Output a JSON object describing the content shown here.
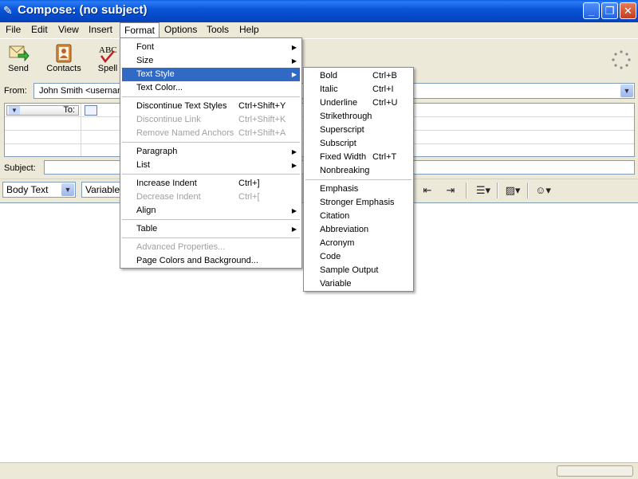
{
  "window": {
    "title": "Compose: (no subject)"
  },
  "menubar": [
    "File",
    "Edit",
    "View",
    "Insert",
    "Format",
    "Options",
    "Tools",
    "Help"
  ],
  "toolbar": {
    "send": "Send",
    "contacts": "Contacts",
    "spell": "Spell"
  },
  "from": {
    "label": "From:",
    "value": "John Smith <usernam"
  },
  "addressing": {
    "type": "To:"
  },
  "subject": {
    "label": "Subject:",
    "value": ""
  },
  "format_bar": {
    "paragraph_style": "Body Text",
    "font": "Variable"
  },
  "format_menu": {
    "font": "Font",
    "size": "Size",
    "text_style": "Text Style",
    "text_color": "Text Color...",
    "discontinue_styles": "Discontinue Text Styles",
    "discontinue_styles_sc": "Ctrl+Shift+Y",
    "discontinue_link": "Discontinue Link",
    "discontinue_link_sc": "Ctrl+Shift+K",
    "remove_anchors": "Remove Named Anchors",
    "remove_anchors_sc": "Ctrl+Shift+A",
    "paragraph": "Paragraph",
    "list": "List",
    "increase_indent": "Increase Indent",
    "increase_indent_sc": "Ctrl+]",
    "decrease_indent": "Decrease Indent",
    "decrease_indent_sc": "Ctrl+[",
    "align": "Align",
    "table": "Table",
    "advanced_properties": "Advanced Properties...",
    "page_colors": "Page Colors and Background..."
  },
  "text_style_menu": {
    "bold": "Bold",
    "bold_sc": "Ctrl+B",
    "italic": "Italic",
    "italic_sc": "Ctrl+I",
    "underline": "Underline",
    "underline_sc": "Ctrl+U",
    "strikethrough": "Strikethrough",
    "superscript": "Superscript",
    "subscript": "Subscript",
    "fixed_width": "Fixed Width",
    "fixed_width_sc": "Ctrl+T",
    "nonbreaking": "Nonbreaking",
    "emphasis": "Emphasis",
    "stronger_emphasis": "Stronger Emphasis",
    "citation": "Citation",
    "abbreviation": "Abbreviation",
    "acronym": "Acronym",
    "code": "Code",
    "sample_output": "Sample Output",
    "variable": "Variable"
  },
  "colors": {
    "titlebar": "#0a56d8",
    "highlight": "#316ac5",
    "chrome": "#ece9d8"
  }
}
